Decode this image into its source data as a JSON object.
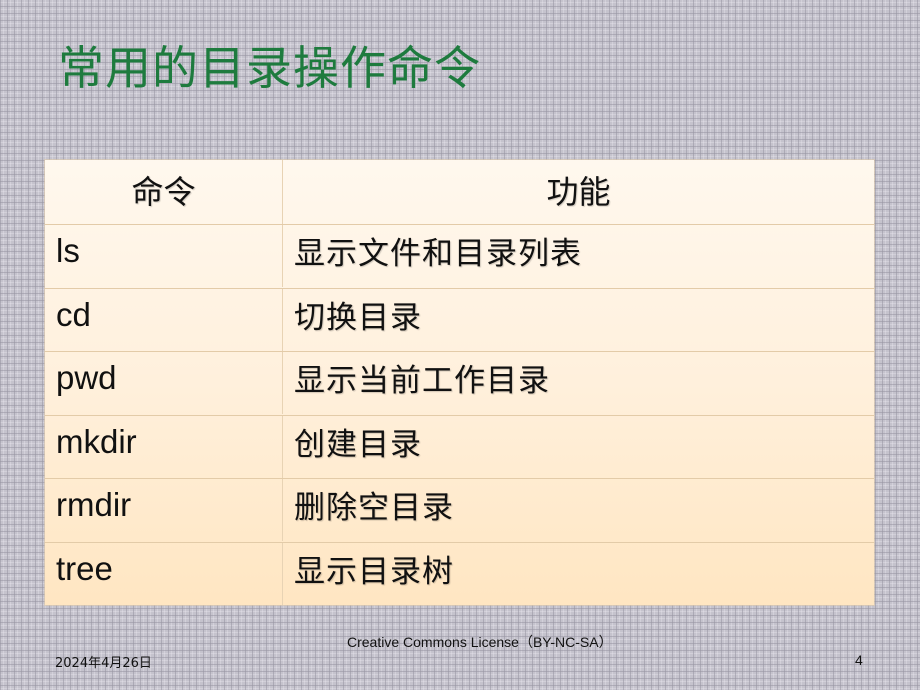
{
  "slide": {
    "title": "常用的目录操作命令",
    "table": {
      "headers": [
        "命令",
        "功能"
      ],
      "rows": [
        {
          "command": "ls",
          "function": "显示文件和目录列表"
        },
        {
          "command": "cd",
          "function": "切换目录"
        },
        {
          "command": "pwd",
          "function": "显示当前工作目录"
        },
        {
          "command": "mkdir",
          "function": "创建目录"
        },
        {
          "command": "rmdir",
          "function": "删除空目录"
        },
        {
          "command": "tree",
          "function": "显示目录树"
        }
      ]
    },
    "footer": {
      "date": "2024年4月26日",
      "license": "Creative Commons License（BY-NC-SA）",
      "page_number": "4"
    },
    "colors": {
      "title": "#1E7B3E",
      "table_top": "#FFF8EE",
      "table_bottom": "#FFE6C2",
      "background": "#C5C3CD"
    }
  }
}
